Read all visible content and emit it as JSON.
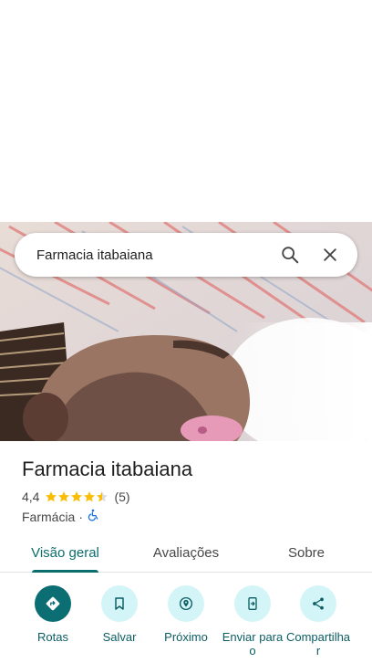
{
  "search": {
    "query": "Farmacia itabaiana",
    "search_icon": "search-icon",
    "close_icon": "close-icon"
  },
  "place": {
    "name": "Farmacia itabaiana",
    "rating": "4,4",
    "stars_value": 4.4,
    "review_count": "(5)",
    "category": "Farmácia",
    "separator": "·",
    "accessibility_icon": "wheelchair-icon"
  },
  "tabs": [
    {
      "label": "Visão geral",
      "active": true
    },
    {
      "label": "Avaliações",
      "active": false
    },
    {
      "label": "Sobre",
      "active": false
    }
  ],
  "actions": [
    {
      "label": "Rotas",
      "icon": "directions-icon"
    },
    {
      "label": "Salvar",
      "icon": "bookmark-icon"
    },
    {
      "label": "Próximo",
      "icon": "nearby-icon"
    },
    {
      "label": "Enviar para o",
      "icon": "send-to-phone-icon"
    },
    {
      "label": "Compartilhar",
      "icon": "share-icon"
    }
  ],
  "colors": {
    "accent": "#0b6e73",
    "action_bg": "#d3f5f7",
    "star": "#fbbc04",
    "accessibility": "#1a73e8"
  }
}
